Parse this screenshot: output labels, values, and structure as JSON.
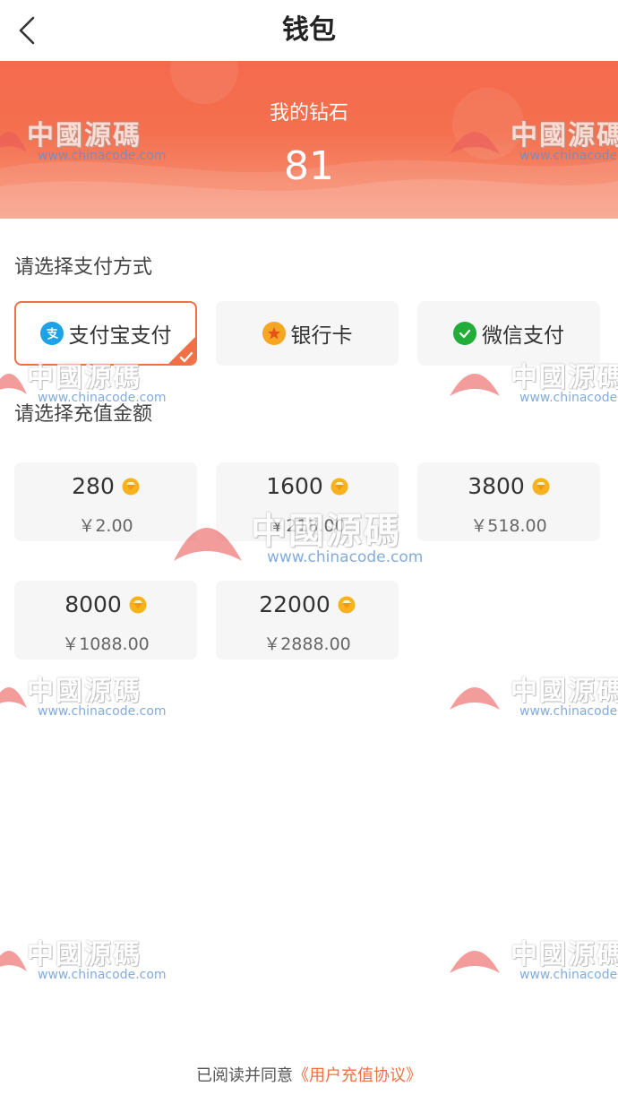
{
  "header": {
    "title": "钱包"
  },
  "balance": {
    "label": "我的钻石",
    "value": "81"
  },
  "payment": {
    "section_title": "请选择支付方式",
    "options": [
      {
        "label": "支付宝支付",
        "icon": "alipay-icon",
        "selected": true
      },
      {
        "label": "银行卡",
        "icon": "bank-card-icon",
        "selected": false
      },
      {
        "label": "微信支付",
        "icon": "wechat-pay-icon",
        "selected": false
      }
    ]
  },
  "recharge": {
    "section_title": "请选择充值金额",
    "options": [
      {
        "diamonds": "280",
        "price": "￥2.00"
      },
      {
        "diamonds": "1600",
        "price": "￥218.00"
      },
      {
        "diamonds": "3800",
        "price": "￥518.00"
      },
      {
        "diamonds": "8000",
        "price": "￥1088.00"
      },
      {
        "diamonds": "22000",
        "price": "￥2888.00"
      }
    ]
  },
  "agreement": {
    "prefix": "已阅读并同意",
    "link": "《用户充值协议》"
  },
  "watermark": {
    "text": "中國源碼",
    "url": "www.chinacode.com"
  },
  "colors": {
    "accent": "#f27046",
    "banner": "#f56a4d",
    "tile": "#f6f6f6"
  }
}
